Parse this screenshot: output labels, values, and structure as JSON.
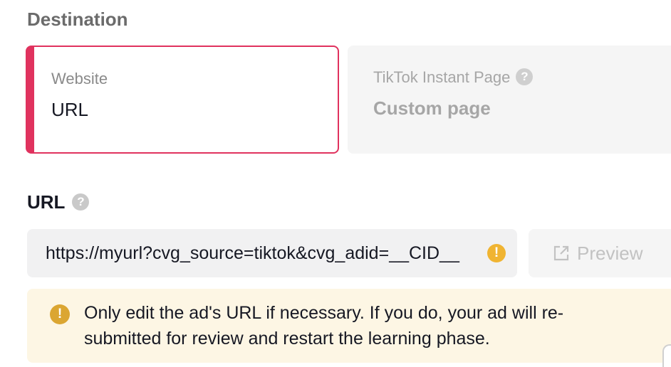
{
  "destination": {
    "title": "Destination",
    "options": [
      {
        "sub_label": "Website",
        "main_label": "URL",
        "selected": true
      },
      {
        "sub_label": "TikTok Instant Page",
        "main_label": "Custom page",
        "selected": false,
        "help_icon": "question-circle-icon"
      }
    ]
  },
  "url": {
    "label": "URL",
    "help_icon": "question-circle-icon",
    "value": "https://myurl?cvg_source=tiktok&cvg_adid=__CID__",
    "warning_icon": "exclamation-circle-icon",
    "preview_label": "Preview",
    "preview_icon": "external-link-icon",
    "preview_enabled": false
  },
  "alert": {
    "icon": "exclamation-circle-icon",
    "text": "Only edit the ad's URL if necessary. If you do, your ad will re-submitted for review and restart the learning phase."
  },
  "colors": {
    "accent": "#e0325e",
    "warning": "#f0b432",
    "alert_bg": "#fdf6e4"
  }
}
